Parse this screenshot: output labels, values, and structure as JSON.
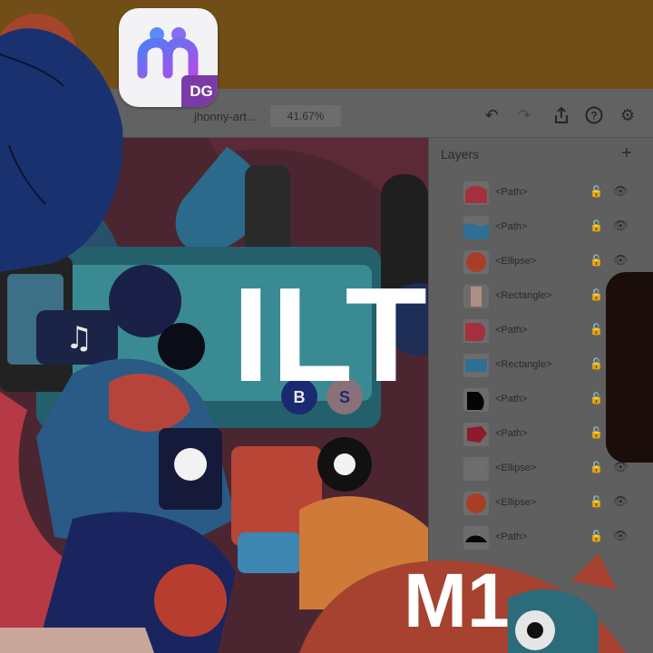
{
  "overlay": {
    "title": "ILT",
    "subtitle": "M1"
  },
  "badge": {
    "tag": "DG",
    "icon": "people-logo-icon"
  },
  "app": {
    "document_name": "jhonny-art...",
    "zoom": "41.67%",
    "toolbar_icons": [
      "undo-icon",
      "redo-icon",
      "share-icon",
      "help-icon",
      "settings-icon"
    ]
  },
  "layers_panel": {
    "title": "Layers",
    "add_icon": "plus-icon",
    "items": [
      {
        "label": "<Path>",
        "thumb_color": "#c0334d"
      },
      {
        "label": "<Path>",
        "thumb_color": "#3a86b5"
      },
      {
        "label": "<Ellipse>",
        "thumb_color": "#c84a2d"
      },
      {
        "label": "<Rectangle>",
        "thumb_color": "#d8b3a3"
      },
      {
        "label": "<Path>",
        "thumb_color": "#c0334d"
      },
      {
        "label": "<Rectangle>",
        "thumb_color": "#3a86b5"
      },
      {
        "label": "<Path>",
        "thumb_color": "#000000"
      },
      {
        "label": "<Path>",
        "thumb_color": "#b21c36"
      },
      {
        "label": "<Ellipse>",
        "thumb_color": "#f2f2f2"
      },
      {
        "label": "<Ellipse>",
        "thumb_color": "#c84a2d"
      },
      {
        "label": "<Path>",
        "thumb_color": "#000000"
      }
    ]
  },
  "colors": {
    "topbar": "#714e17",
    "badge_tag": "#7b3aa8",
    "overlay_text": "#ffffff"
  }
}
